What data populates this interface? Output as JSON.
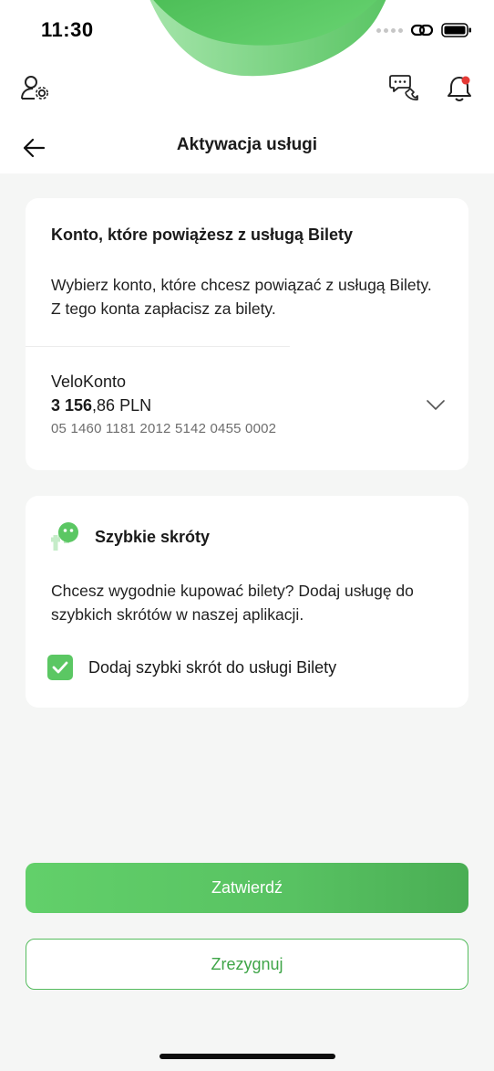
{
  "status_bar": {
    "time": "11:30"
  },
  "nav": {
    "title": "Aktywacja usługi"
  },
  "account_card": {
    "title": "Konto, które powiążesz z usługą Bilety",
    "description": "Wybierz konto, które chcesz powiązać z usługą Bilety. Z tego konta zapłacisz za bilety.",
    "account_name": "VeloKonto",
    "balance_main": "3 156",
    "balance_rest": ",86 PLN",
    "account_number": "05 1460 1181 2012 5142 0455 0002"
  },
  "shortcuts_card": {
    "title": "Szybkie skróty",
    "description": "Chcesz wygodnie kupować bilety? Dodaj usługę do szybkich skrótów w naszej aplikacji.",
    "checkbox_label": "Dodaj szybki skrót do usługi Bilety",
    "checked": true
  },
  "buttons": {
    "confirm": "Zatwierdź",
    "cancel": "Zrezygnuj"
  },
  "colors": {
    "accent": "#5bc763",
    "accent_dark": "#3fa548",
    "notification_dot": "#e53935",
    "background": "#f5f6f5"
  },
  "icons": [
    "user-settings-icon",
    "chat-phone-icon",
    "bell-icon",
    "back-arrow-icon",
    "chevron-down-icon",
    "shortcut-icon",
    "checkmark-icon",
    "link-icon",
    "battery-icon"
  ]
}
